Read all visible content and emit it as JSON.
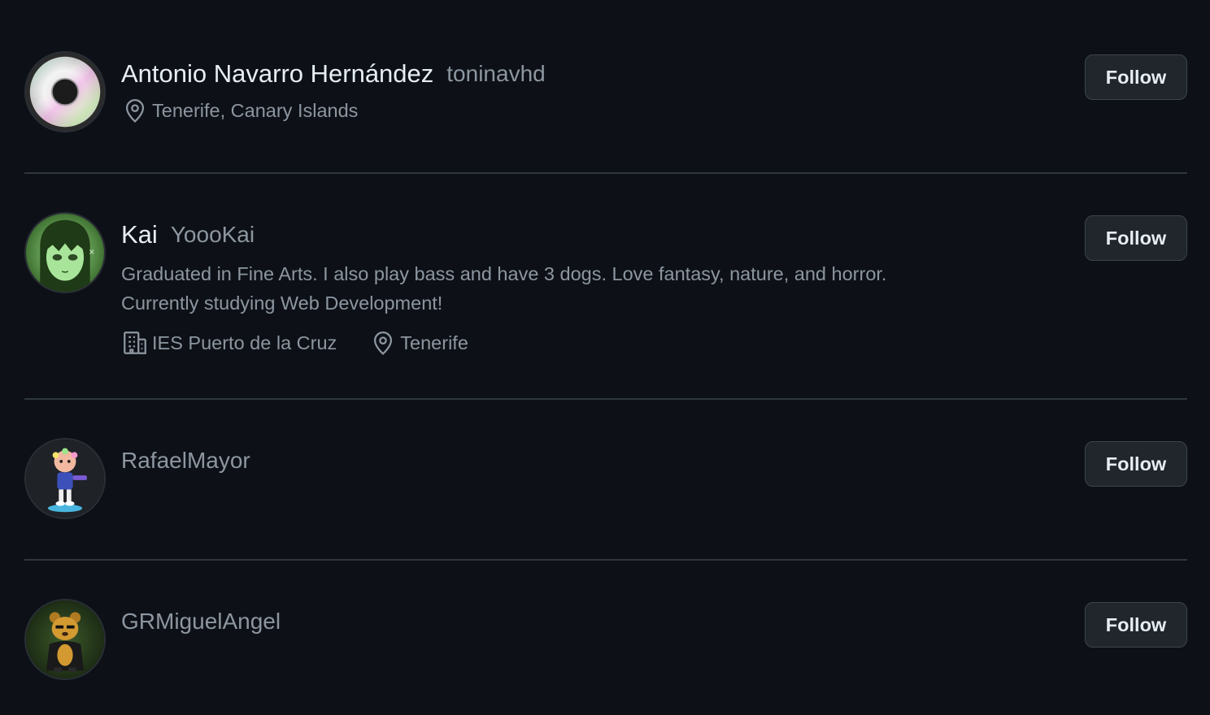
{
  "users": [
    {
      "display_name": "Antonio Navarro Hernández",
      "login": "toninavhd",
      "location": "Tenerife, Canary Islands",
      "follow_label": "Follow",
      "avatar_icon": "cd-disc-avatar"
    },
    {
      "display_name": "Kai",
      "login": "YoooKai",
      "bio_line1": "Graduated in Fine Arts. I also play bass and have 3 dogs. Love fantasy, nature, and horror.",
      "bio_line2": "Currently studying Web Development!",
      "company": "IES Puerto de la Cruz",
      "location": "Tenerife",
      "follow_label": "Follow",
      "avatar_icon": "anime-girl-avatar"
    },
    {
      "login": "RafaelMayor",
      "follow_label": "Follow",
      "avatar_icon": "cartoon-character-avatar"
    },
    {
      "login": "GRMiguelAngel",
      "follow_label": "Follow",
      "avatar_icon": "bear-avatar"
    }
  ],
  "icons": {
    "location": "location-pin-icon",
    "company": "building-icon"
  },
  "colors": {
    "background": "#0d1117",
    "text_primary": "#e6edf3",
    "text_muted": "#8d96a0",
    "button_bg": "#21262d",
    "button_border": "#3d444d",
    "divider": "#30363d"
  }
}
